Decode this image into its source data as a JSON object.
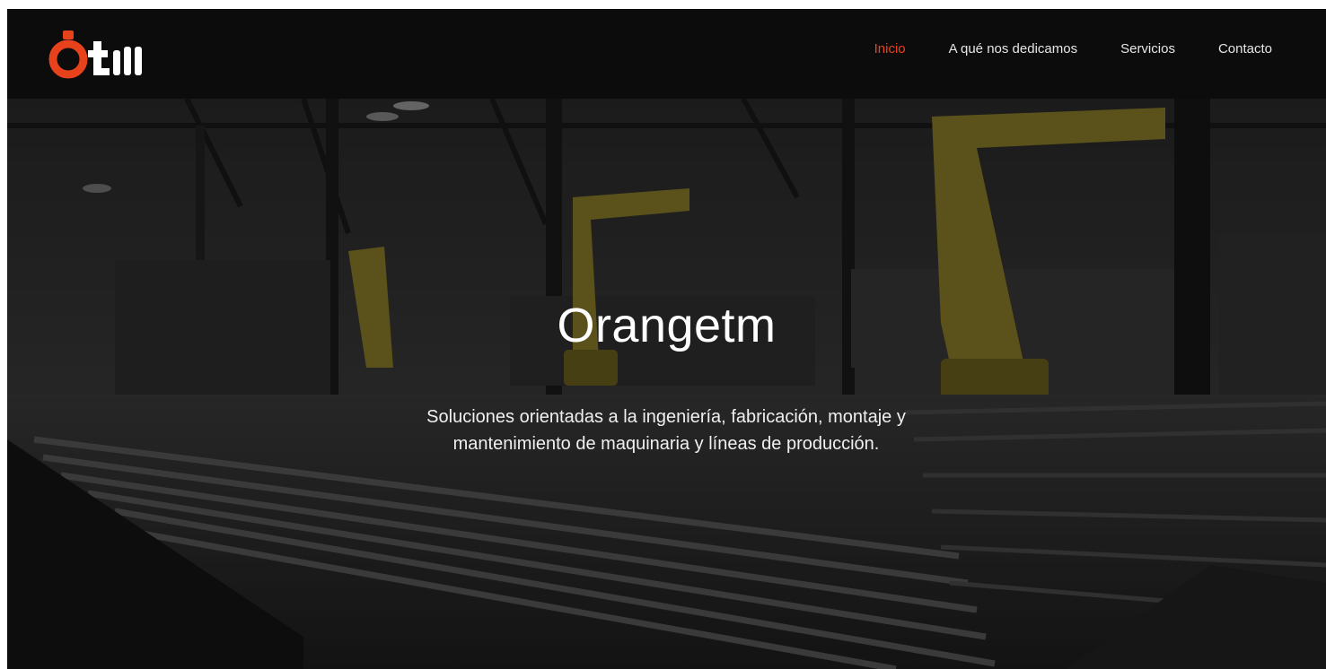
{
  "brand": {
    "logo_text": "Otm",
    "accent_color": "#e8421c"
  },
  "nav": {
    "items": [
      {
        "label": "Inicio",
        "active": true
      },
      {
        "label": "A qué nos dedicamos",
        "active": false
      },
      {
        "label": "Servicios",
        "active": false
      },
      {
        "label": "Contacto",
        "active": false
      }
    ]
  },
  "hero": {
    "title": "Orangetm",
    "subtitle": "Soluciones orientadas a la ingeniería, fabricación, montaje y mantenimiento de maquinaria y líneas de producción.",
    "background": "industrial-factory-robots-image"
  }
}
